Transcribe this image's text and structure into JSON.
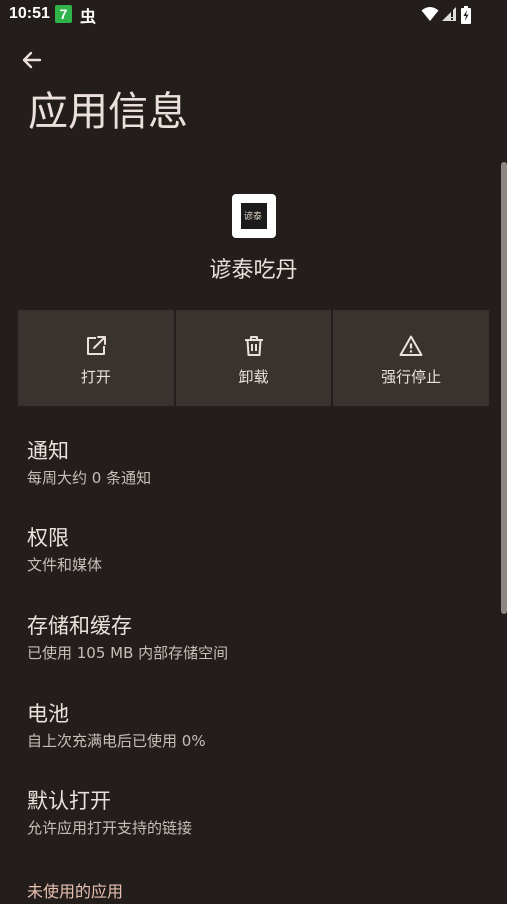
{
  "status_bar": {
    "time": "10:51",
    "notif_badge": "7",
    "notif_glyph": "虫"
  },
  "page": {
    "title": "应用信息"
  },
  "app": {
    "icon_text": "谚泰",
    "name": "谚泰吃丹"
  },
  "actions": [
    {
      "label": "打开",
      "icon": "open-external-icon"
    },
    {
      "label": "卸载",
      "icon": "trash-icon"
    },
    {
      "label": "强行停止",
      "icon": "warning-icon"
    }
  ],
  "settings": [
    {
      "title": "通知",
      "summary": "每周大约 0 条通知"
    },
    {
      "title": "权限",
      "summary": "文件和媒体"
    },
    {
      "title": "存储和缓存",
      "summary": "已使用 105 MB 内部存储空间"
    },
    {
      "title": "电池",
      "summary": "自上次充满电后已使用 0%"
    },
    {
      "title": "默认打开",
      "summary": "允许应用打开支持的链接"
    }
  ],
  "section_header": "未使用的应用",
  "colors": {
    "background": "#231e1c",
    "button_bg": "#39332f",
    "text_primary": "#ece0dc",
    "text_secondary": "#c9bdb8",
    "accent": "#e8c0b0"
  }
}
